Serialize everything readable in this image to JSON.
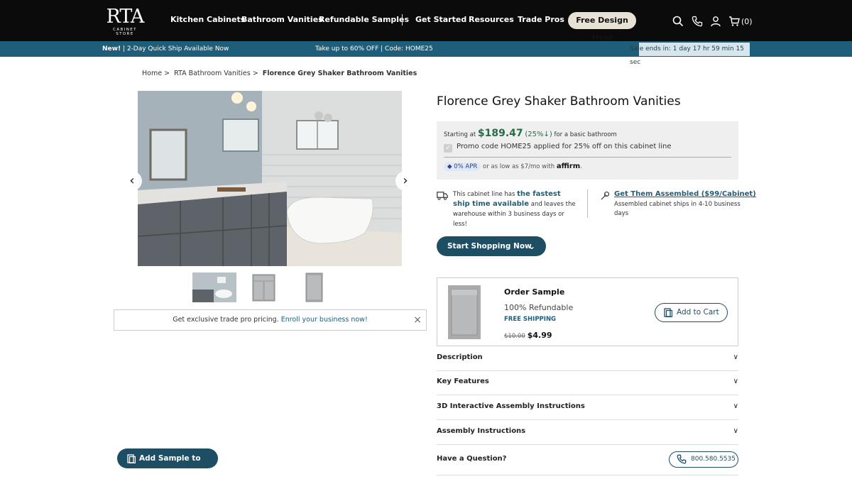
{
  "header": {
    "logo_text": "RTA",
    "logo_sub": "CABINET STORE",
    "nav": [
      "Kitchen Cabinets",
      "Bathroom Vanities",
      "Refundable Samples",
      "Get Started",
      "Resources",
      "Trade Pros"
    ],
    "free_help": "Free Design Help",
    "cart_count": "(0)",
    "icons": [
      "search-icon",
      "phone-icon",
      "account-icon",
      "cart-icon"
    ]
  },
  "promo_bar": {
    "left_bold": "New!",
    "left_text": " | 2-Day Quick Ship Available Now",
    "middle": "Take up to 60% OFF |  Code: HOME25",
    "sale": "Sale ends in: 1 day 17 hr 59 min 15 sec"
  },
  "breadcrumb": {
    "home": "Home >",
    "category": "RTA Bathroom Vanities >",
    "current": "Florence Grey Shaker Bathroom Vanities"
  },
  "gallery": {
    "prev": "‹",
    "next": "›",
    "thumbnails": [
      "bathroom-scene",
      "base-cabinet",
      "tall-cabinet"
    ]
  },
  "trade_banner": {
    "text": "Get exclusive trade pro pricing. ",
    "link": "Enroll your business now!",
    "close": "×"
  },
  "sample_cta": "Add Sample to Cart",
  "product": {
    "title": "Florence Grey Shaker Bathroom Vanities",
    "price_prefix": "Starting at ",
    "price": "$189.47",
    "discount": "(25%↓)",
    "price_suffix": " for a basic bathroom",
    "promo_applied": "Promo code HOME25 applied for 25% off on this cabinet line",
    "apr": "0% APR",
    "apr_text": " or as low as $7/mo with ",
    "affirm": "affirm"
  },
  "shipping": {
    "pre": "This cabinet line has ",
    "highlight": "the fastest ship time available",
    "post": " and leaves the warehouse within 3 business days or less!"
  },
  "assembly": {
    "link": "Get Them Assembled ($99/Cabinet)",
    "text": "Assembled cabinet ships in 4-10 business days"
  },
  "shop_button": "Start Shopping Now",
  "sample_card": {
    "title": "Order Sample",
    "refundable": "100% Refundable",
    "shipping": "FREE SHIPPING",
    "old_price": "$10.00",
    "new_price": "$4.99",
    "add": "Add to Cart"
  },
  "accordion": [
    "Description",
    "Key Features",
    "3D Interactive Assembly Instructions",
    "Assembly Instructions"
  ],
  "question": {
    "label": "Have a Question?",
    "phone": "800.580.5535"
  },
  "colors": {
    "brand_teal": "#1d4e63",
    "promo_bar": "#1f5e7a",
    "price_green": "#2a6a46"
  }
}
